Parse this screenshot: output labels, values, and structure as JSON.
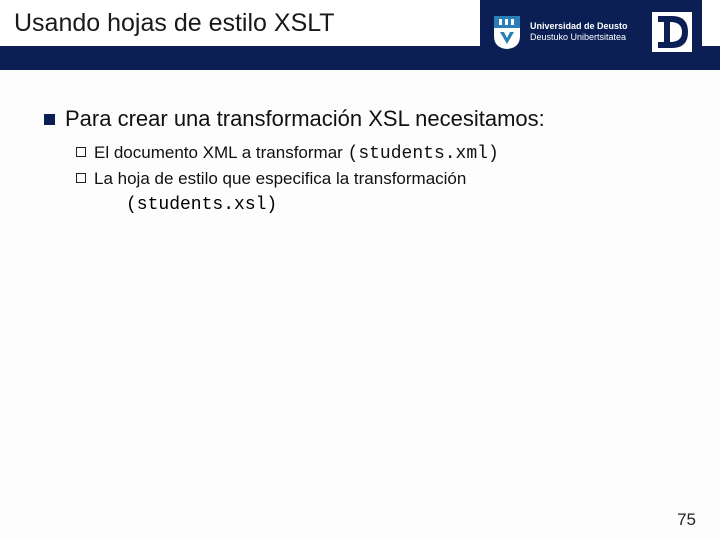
{
  "header": {
    "title": "Usando hojas de estilo XSLT",
    "university": {
      "line1": "Universidad de Deusto",
      "line2": "Deustuko Unibertsitatea"
    }
  },
  "content": {
    "main_bullet": "Para crear una transformación XSL necesitamos:",
    "sub_bullets": [
      {
        "text_pre": "El documento XML a transformar ",
        "code": "(students.xml)"
      },
      {
        "text_pre": "La hoja de estilo que especifica la transformación",
        "code": "(students.xsl)"
      }
    ]
  },
  "page_number": "75"
}
